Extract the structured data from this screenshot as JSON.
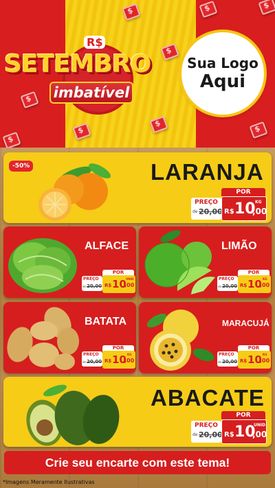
{
  "header": {
    "currency_symbol": "R$",
    "title": "SETEMBRO",
    "subtitle": "imbatível",
    "logo_line1": "Sua Logo",
    "logo_line2": "Aqui"
  },
  "products": [
    {
      "name": "LARANJA",
      "badge": "-50%",
      "por": "POR",
      "preco": "PREÇO",
      "old_de": "de",
      "old_price": "20,00",
      "currency": "R$",
      "price": "10",
      "cents": ",00",
      "unit": "KG"
    },
    {
      "name": "ALFACE",
      "por": "POR",
      "preco": "PREÇO",
      "old_de": "de",
      "old_price": "20,00",
      "currency": "R$",
      "price": "10",
      "cents": ",00",
      "unit": "UNID"
    },
    {
      "name": "LIMÃO",
      "por": "POR",
      "preco": "PREÇO",
      "old_de": "de",
      "old_price": "20,00",
      "currency": "R$",
      "price": "10",
      "cents": ",00",
      "unit": "KG"
    },
    {
      "name": "BATATA",
      "por": "POR",
      "preco": "PREÇO",
      "old_de": "de",
      "old_price": "20,00",
      "currency": "R$",
      "price": "10",
      "cents": ",00",
      "unit": "KG"
    },
    {
      "name": "MARACUJÁ",
      "por": "POR",
      "preco": "PREÇO",
      "old_de": "de",
      "old_price": "20,00",
      "currency": "R$",
      "price": "10",
      "cents": ",00",
      "unit": "KG"
    },
    {
      "name": "ABACATE",
      "por": "POR",
      "preco": "PREÇO",
      "old_de": "de",
      "old_price": "20,00",
      "currency": "R$",
      "price": "10",
      "cents": ",00",
      "unit": "UNID"
    }
  ],
  "cta": "Crie seu encarte com este tema!",
  "footnote": "*Imagens Meramente Ilustrativas",
  "colors": {
    "red": "#d61e1e",
    "yellow": "#f6cc17",
    "wood": "#b98a4e"
  }
}
